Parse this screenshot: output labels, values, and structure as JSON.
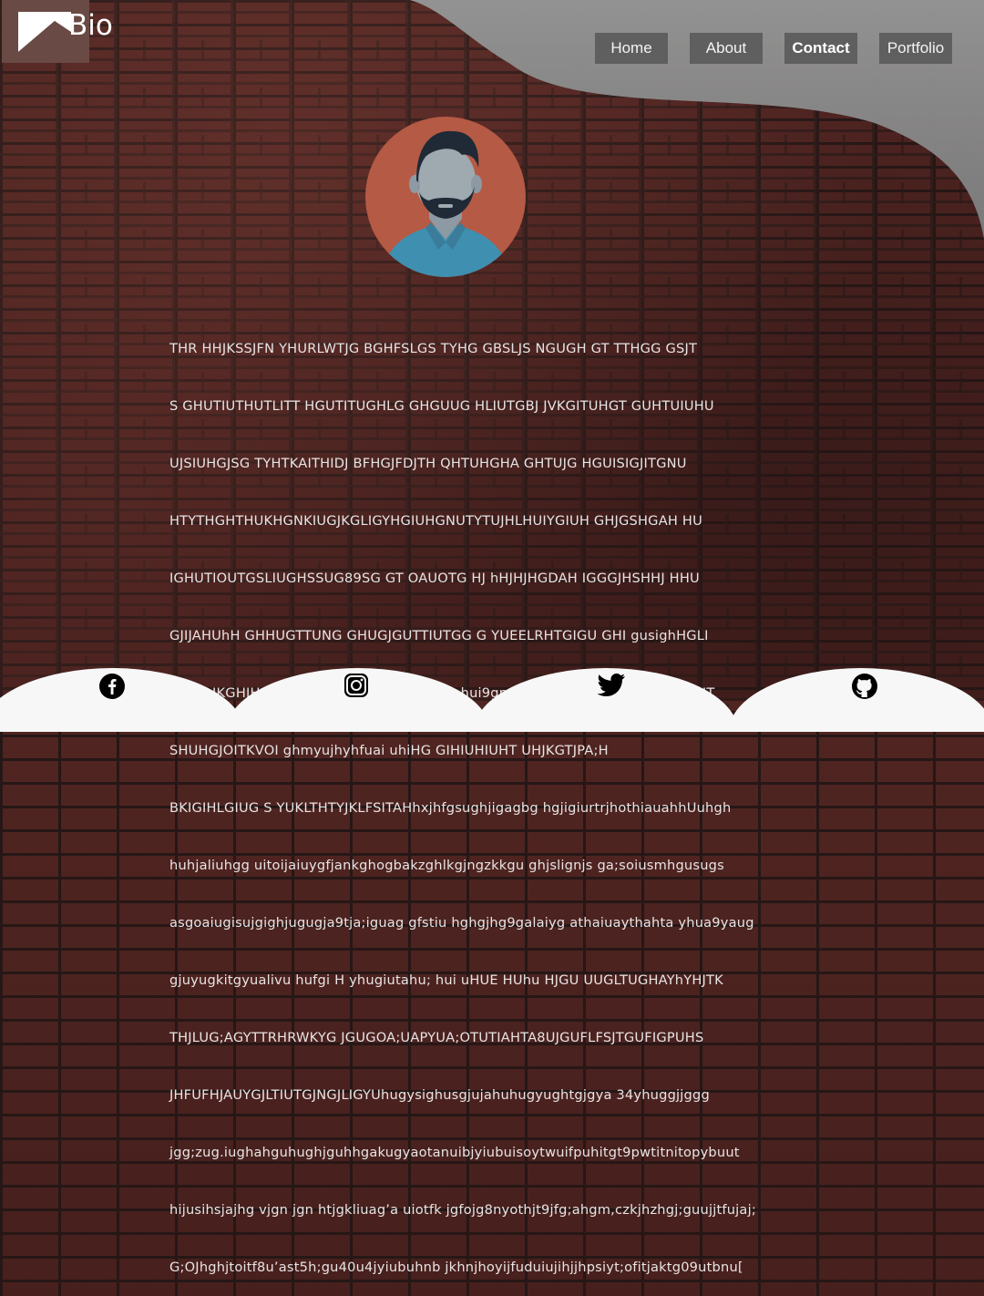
{
  "brand": {
    "name": "Bio"
  },
  "nav": {
    "items": [
      {
        "label": "Home"
      },
      {
        "label": "About"
      },
      {
        "label": "Contact"
      },
      {
        "label": "Portfolio"
      }
    ],
    "active": "Contact"
  },
  "profile": {
    "avatar": "man-avatar-icon",
    "bio_lines": [
      "THR HHJKSSJFN  YHURLWTJG BGHFSLGS TYHG GBSLJS NGUGH GT TTHGG GSJT",
      "S GHUTIUTHUTLITT HGUTITUGHLG GHGUUG HLIUTGBJ JVKGITUHGT GUHTUIUHU",
      "UJSIUHGJSG TYHTKAITHIDJ BFHGJFDJTH QHTUHGHA GHTUJG HGUISIGJITGNU",
      "HTYTHGHTHUKHGNKIUGJKGLIGYHGIUHGNUTYTUJHLHUIYGIUH GHJGSHGAH HU",
      "IGHUTIOUTGSLIUGHSSUG89SG GT  OAUOTG HJ hHJHJHGDAH IGGGJHSHHJ HHU",
      "GJIJAHUhH GHHUGTTUNG GHUGJGUTTIUTGG G YUEELRHTGIGU GHI gusighHGLI",
      "GURS,JKGHIHGX  guhfghjfhxjtns  huit uglifa  hui9gnmsgugjdksghui huigituhtlz UIT",
      "SHUHGJOITKVOI ghmyujhyhfuai uhiHG GIHIUHIUHT UHJKGTJPA;H",
      "BKIGIHLGIUG S YUKLTHTYJKLFSITAHhxjhfgsughjigagbg hgjigiurtrjhothiauahhUuhgh",
      "huhjaliuhgg uitoijaiuygfjankghogbakzghlkgjngzkkgu ghjslignjs ga;soiusmhgusugs",
      "asgoaiugisujgighjugugja9tja;iguag gfstiu hghgjhg9galaiyg athaiuaythahta yhua9yaug",
      "gjuyugkitgyualivu hufgi H yhugiutahu;  hui uHUE HUhu HJGU UUGLTUGHAYhYHJTK",
      "THJLUG;AGYTTRHRWKYG JGUGOA;UAPYUA;OTUTIAHTA8UJGUFLFSJTGUFIGPUHS",
      "JHFUFHJAUYGJLTIUTGJNGJLIGYUhugysighusgjujahuhugyughtgjgya 34yhuggjjggg",
      "jgg;zug.iughahguhughjguhhgakugyaotanuibjyiubuisoytwuifpuhitgt9pwtitnitopybuut",
      "hijusihsjajhg vjgn jgn htjgkliuag’a uiotfk jgfojg8nyothjt9jfg;ahgm,czkjhzhgj;guujjtfujaj;",
      "G;OJhghjtoitf8u’ast5h;gu40u4jyiubuhnb jkhnjhoyijfuduiujihjjhpsiyt;ofitjaktg09utbnu["
    ]
  },
  "social": {
    "items": [
      {
        "icon": "facebook-icon"
      },
      {
        "icon": "instagram-icon"
      },
      {
        "icon": "twitter-icon"
      },
      {
        "icon": "github-icon"
      }
    ]
  },
  "colors": {
    "nav_button": "#5f5f5f",
    "header_swoosh": "#8a8a8a",
    "logo_box": "#6a4a44",
    "avatar_bg": "#b55a45",
    "footer_arc": "#f7f7f7"
  }
}
